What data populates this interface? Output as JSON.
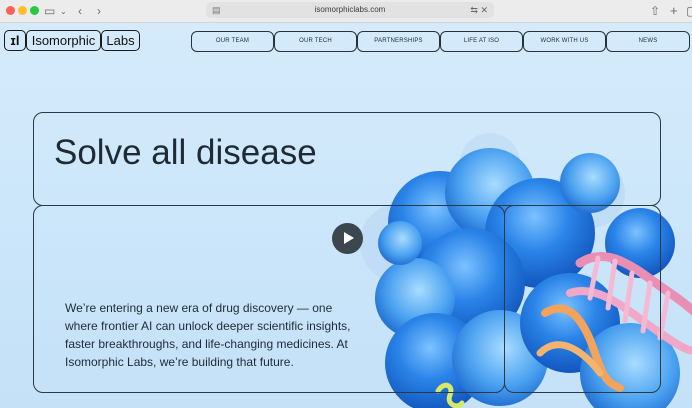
{
  "browser": {
    "url": "isomorphiclabs.com"
  },
  "site": {
    "logo_mark": "ɪl",
    "logo_word1": "Isomorphic",
    "logo_word2": "Labs",
    "nav": [
      "OUR TEAM",
      "OUR TECH",
      "PARTNERSHIPS",
      "LIFE AT ISO",
      "WORK WITH US",
      "NEWS"
    ]
  },
  "hero": {
    "title": "Solve all disease",
    "body": "We’re entering a new era of drug discovery — one where frontier AI can unlock deeper scientific insights, faster breakthroughs, and life-changing medicines. At Isomorphic Labs, we’re building that future."
  },
  "colors": {
    "page_bg": "#cfe8fb",
    "protein_blue": "#1e6fd8",
    "dna_pink": "#e98fb6",
    "dna_orange": "#f2a35c"
  },
  "icons": {
    "back": "chevron-left-icon",
    "forward": "chevron-right-icon",
    "sidebar": "sidebar-icon",
    "share": "share-icon",
    "new_tab": "plus-icon",
    "translate": "translate-icon",
    "play": "play-icon"
  }
}
